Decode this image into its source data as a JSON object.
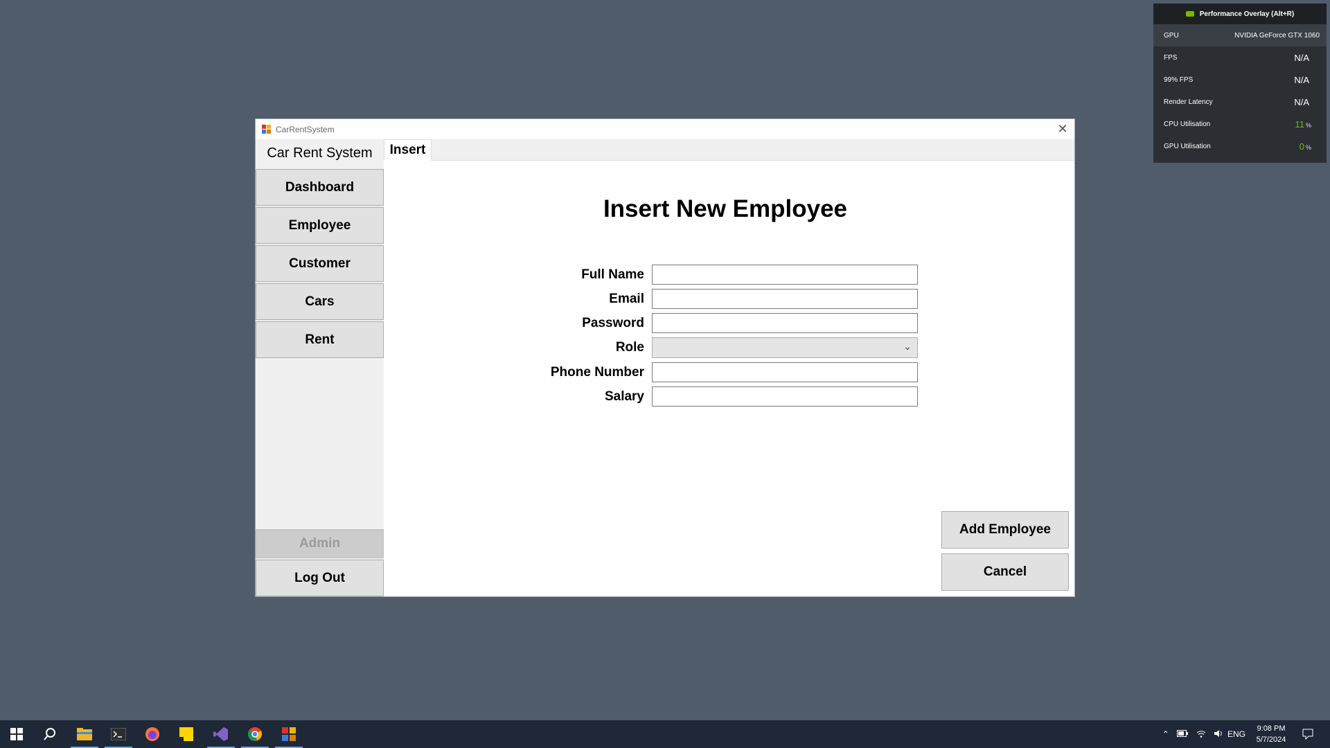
{
  "overlay": {
    "title": "Performance Overlay (Alt+R)",
    "rows": [
      {
        "label": "GPU",
        "value": "NVIDIA GeForce GTX 1060"
      },
      {
        "label": "FPS",
        "value": "N/A"
      },
      {
        "label": "99% FPS",
        "value": "N/A"
      },
      {
        "label": "Render Latency",
        "value": "N/A"
      },
      {
        "label": "CPU Utilisation",
        "value": "11",
        "unit": "%"
      },
      {
        "label": "GPU Utilisation",
        "value": "0",
        "unit": "%"
      }
    ]
  },
  "window": {
    "title": "CarRentSystem",
    "brand": "Car Rent System",
    "nav": [
      "Dashboard",
      "Employee",
      "Customer",
      "Cars",
      "Rent"
    ],
    "admin_label": "Admin",
    "logout_label": "Log Out",
    "tab_label": "Insert"
  },
  "form": {
    "title": "Insert New Employee",
    "labels": {
      "full_name": "Full Name",
      "email": "Email",
      "password": "Password",
      "role": "Role",
      "phone": "Phone Number",
      "salary": "Salary"
    },
    "values": {
      "full_name": "",
      "email": "",
      "password": "",
      "role": "",
      "phone": "",
      "salary": ""
    },
    "add_label": "Add Employee",
    "cancel_label": "Cancel"
  },
  "taskbar": {
    "icons": [
      "windows-start-icon",
      "search-icon",
      "file-explorer-icon",
      "terminal-icon",
      "firefox-icon",
      "sticky-notes-icon",
      "visual-studio-icon",
      "chrome-icon",
      "car-rent-app-icon"
    ],
    "language": "ENG",
    "time": "9:08 PM",
    "date": "5/7/2024"
  },
  "colors": {
    "desktop": "#515c6b",
    "nvidia_green": "#76b900",
    "taskbar": "#1f2836"
  }
}
